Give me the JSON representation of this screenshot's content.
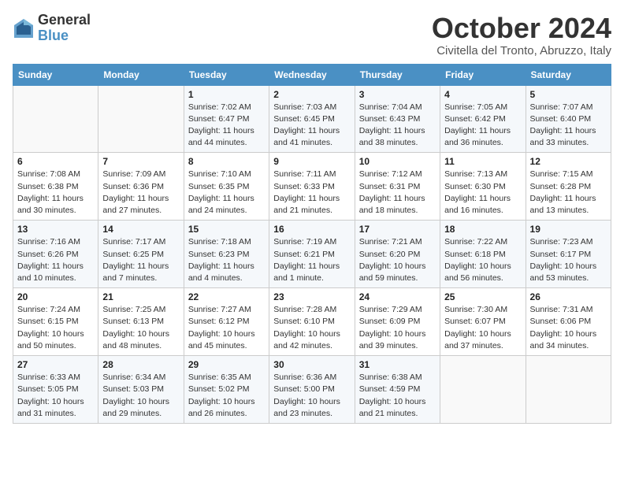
{
  "header": {
    "logo_line1": "General",
    "logo_line2": "Blue",
    "month_title": "October 2024",
    "location": "Civitella del Tronto, Abruzzo, Italy"
  },
  "weekdays": [
    "Sunday",
    "Monday",
    "Tuesday",
    "Wednesday",
    "Thursday",
    "Friday",
    "Saturday"
  ],
  "weeks": [
    [
      {
        "day": "",
        "info": ""
      },
      {
        "day": "",
        "info": ""
      },
      {
        "day": "1",
        "info": "Sunrise: 7:02 AM\nSunset: 6:47 PM\nDaylight: 11 hours\nand 44 minutes."
      },
      {
        "day": "2",
        "info": "Sunrise: 7:03 AM\nSunset: 6:45 PM\nDaylight: 11 hours\nand 41 minutes."
      },
      {
        "day": "3",
        "info": "Sunrise: 7:04 AM\nSunset: 6:43 PM\nDaylight: 11 hours\nand 38 minutes."
      },
      {
        "day": "4",
        "info": "Sunrise: 7:05 AM\nSunset: 6:42 PM\nDaylight: 11 hours\nand 36 minutes."
      },
      {
        "day": "5",
        "info": "Sunrise: 7:07 AM\nSunset: 6:40 PM\nDaylight: 11 hours\nand 33 minutes."
      }
    ],
    [
      {
        "day": "6",
        "info": "Sunrise: 7:08 AM\nSunset: 6:38 PM\nDaylight: 11 hours\nand 30 minutes."
      },
      {
        "day": "7",
        "info": "Sunrise: 7:09 AM\nSunset: 6:36 PM\nDaylight: 11 hours\nand 27 minutes."
      },
      {
        "day": "8",
        "info": "Sunrise: 7:10 AM\nSunset: 6:35 PM\nDaylight: 11 hours\nand 24 minutes."
      },
      {
        "day": "9",
        "info": "Sunrise: 7:11 AM\nSunset: 6:33 PM\nDaylight: 11 hours\nand 21 minutes."
      },
      {
        "day": "10",
        "info": "Sunrise: 7:12 AM\nSunset: 6:31 PM\nDaylight: 11 hours\nand 18 minutes."
      },
      {
        "day": "11",
        "info": "Sunrise: 7:13 AM\nSunset: 6:30 PM\nDaylight: 11 hours\nand 16 minutes."
      },
      {
        "day": "12",
        "info": "Sunrise: 7:15 AM\nSunset: 6:28 PM\nDaylight: 11 hours\nand 13 minutes."
      }
    ],
    [
      {
        "day": "13",
        "info": "Sunrise: 7:16 AM\nSunset: 6:26 PM\nDaylight: 11 hours\nand 10 minutes."
      },
      {
        "day": "14",
        "info": "Sunrise: 7:17 AM\nSunset: 6:25 PM\nDaylight: 11 hours\nand 7 minutes."
      },
      {
        "day": "15",
        "info": "Sunrise: 7:18 AM\nSunset: 6:23 PM\nDaylight: 11 hours\nand 4 minutes."
      },
      {
        "day": "16",
        "info": "Sunrise: 7:19 AM\nSunset: 6:21 PM\nDaylight: 11 hours\nand 1 minute."
      },
      {
        "day": "17",
        "info": "Sunrise: 7:21 AM\nSunset: 6:20 PM\nDaylight: 10 hours\nand 59 minutes."
      },
      {
        "day": "18",
        "info": "Sunrise: 7:22 AM\nSunset: 6:18 PM\nDaylight: 10 hours\nand 56 minutes."
      },
      {
        "day": "19",
        "info": "Sunrise: 7:23 AM\nSunset: 6:17 PM\nDaylight: 10 hours\nand 53 minutes."
      }
    ],
    [
      {
        "day": "20",
        "info": "Sunrise: 7:24 AM\nSunset: 6:15 PM\nDaylight: 10 hours\nand 50 minutes."
      },
      {
        "day": "21",
        "info": "Sunrise: 7:25 AM\nSunset: 6:13 PM\nDaylight: 10 hours\nand 48 minutes."
      },
      {
        "day": "22",
        "info": "Sunrise: 7:27 AM\nSunset: 6:12 PM\nDaylight: 10 hours\nand 45 minutes."
      },
      {
        "day": "23",
        "info": "Sunrise: 7:28 AM\nSunset: 6:10 PM\nDaylight: 10 hours\nand 42 minutes."
      },
      {
        "day": "24",
        "info": "Sunrise: 7:29 AM\nSunset: 6:09 PM\nDaylight: 10 hours\nand 39 minutes."
      },
      {
        "day": "25",
        "info": "Sunrise: 7:30 AM\nSunset: 6:07 PM\nDaylight: 10 hours\nand 37 minutes."
      },
      {
        "day": "26",
        "info": "Sunrise: 7:31 AM\nSunset: 6:06 PM\nDaylight: 10 hours\nand 34 minutes."
      }
    ],
    [
      {
        "day": "27",
        "info": "Sunrise: 6:33 AM\nSunset: 5:05 PM\nDaylight: 10 hours\nand 31 minutes."
      },
      {
        "day": "28",
        "info": "Sunrise: 6:34 AM\nSunset: 5:03 PM\nDaylight: 10 hours\nand 29 minutes."
      },
      {
        "day": "29",
        "info": "Sunrise: 6:35 AM\nSunset: 5:02 PM\nDaylight: 10 hours\nand 26 minutes."
      },
      {
        "day": "30",
        "info": "Sunrise: 6:36 AM\nSunset: 5:00 PM\nDaylight: 10 hours\nand 23 minutes."
      },
      {
        "day": "31",
        "info": "Sunrise: 6:38 AM\nSunset: 4:59 PM\nDaylight: 10 hours\nand 21 minutes."
      },
      {
        "day": "",
        "info": ""
      },
      {
        "day": "",
        "info": ""
      }
    ]
  ]
}
